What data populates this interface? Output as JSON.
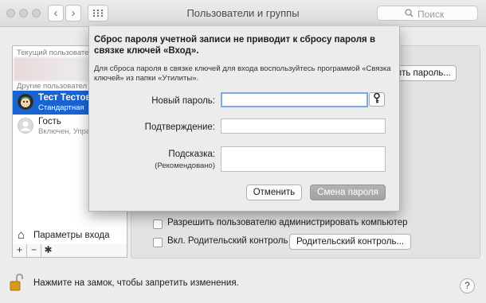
{
  "window": {
    "title": "Пользователи и группы",
    "search_placeholder": "Поиск",
    "nav_back": "‹",
    "nav_forward": "›",
    "grid_icon": "grid-icon",
    "search_icon": "search-icon"
  },
  "sidebar": {
    "current_header": "Текущий пользовате",
    "others_header": "Другие пользовател",
    "users": [
      {
        "name": "Тест Тестови",
        "role": "Стандартная"
      },
      {
        "name": "Гость",
        "role": "Включен, Упра"
      }
    ],
    "login_options_label": "Параметры входа",
    "add_label": "+",
    "remove_label": "−",
    "gear_label": "✱"
  },
  "right_pane": {
    "change_password_button": "ить пароль...",
    "allow_admin_label": "Разрешить пользователю администрировать компьютер",
    "parental_controls_label": "Вкл. Родительский контроль",
    "parental_controls_button": "Родительский контроль..."
  },
  "sheet": {
    "title": "Сброс пароля учетной записи не приводит к сбросу пароля в связке ключей «Вход».",
    "description": "Для сброса пароля в связке ключей для входа воспользуйтесь программой «Связка ключей» из папки «Утилиты».",
    "new_password_label": "Новый пароль:",
    "confirm_label": "Подтверждение:",
    "hint_label": "Подсказка:",
    "hint_sublabel": "(Рекомендовано)",
    "new_password_value": "",
    "confirm_value": "",
    "hint_value": "",
    "cancel_button": "Отменить",
    "submit_button": "Смена пароля",
    "key_icon": "key-icon"
  },
  "footer": {
    "lock_text": "Нажмите на замок, чтобы запретить изменения.",
    "help_label": "?"
  },
  "colors": {
    "selection": "#1a64d2",
    "primary_button": "#a8a8a8"
  }
}
